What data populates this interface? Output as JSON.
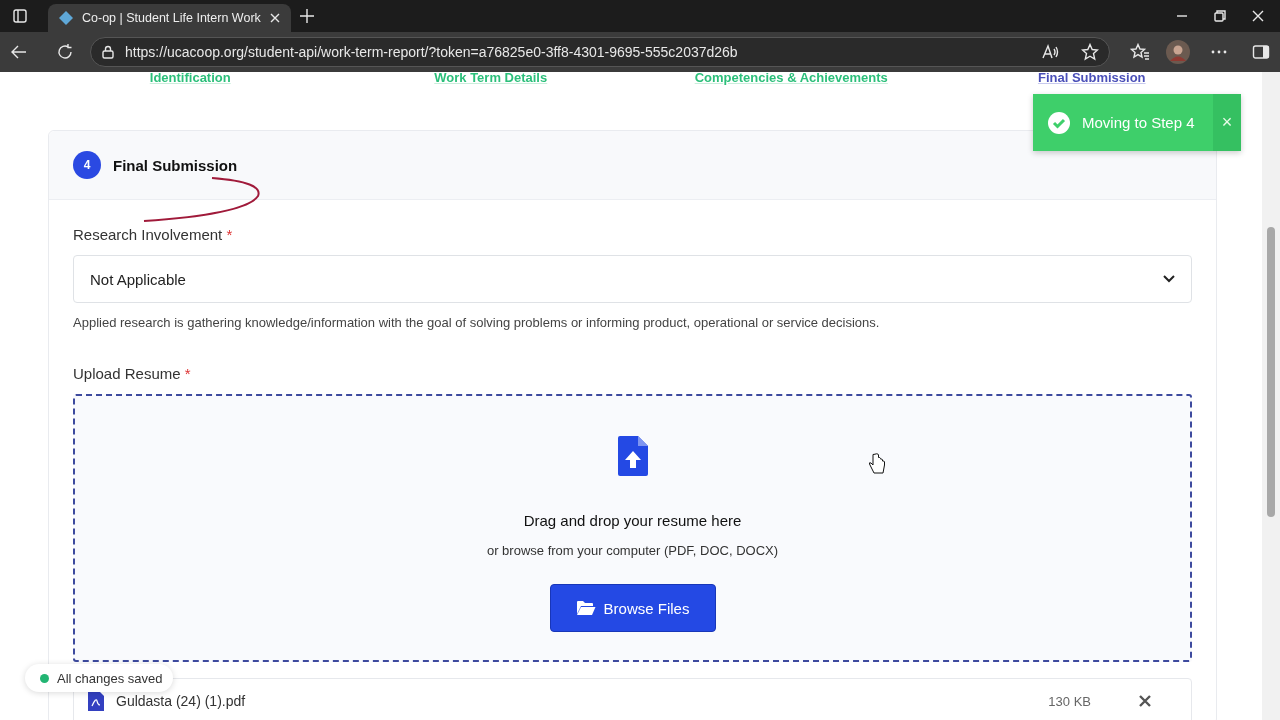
{
  "browser": {
    "tab_title": "Co-op | Student Life Intern Work",
    "url": "https://ucacoop.org/student-api/work-term-report/?token=a76825e0-3ff8-4301-9695-555c2037d26b"
  },
  "steps": [
    {
      "label": "Identification",
      "selected": false
    },
    {
      "label": "Work Term Details",
      "selected": false
    },
    {
      "label": "Competencies & Achievements",
      "selected": false
    },
    {
      "label": "Final Submission",
      "selected": true
    }
  ],
  "section": {
    "number": "4",
    "title": "Final Submission"
  },
  "fields": [
    {
      "kind": "select",
      "label": "Research Involvement",
      "required_mark": "*",
      "value": "Not Applicable",
      "help": "Applied research is gathering knowledge/information with the goal of solving problems or informing product, operational or service decisions."
    },
    {
      "kind": "upload",
      "label": "Upload Resume",
      "required_mark": "*",
      "prompt": "Drag and drop your resume here",
      "hint": "or browse from your computer (PDF, DOC, DOCX)",
      "button": "Browse Files"
    }
  ],
  "files": [
    {
      "name": "Guldasta (24) (1).pdf",
      "size": "130 KB"
    }
  ],
  "toast": {
    "message": "Moving to Step 4",
    "close": "×"
  },
  "autosave": {
    "label": "All changes saved"
  }
}
